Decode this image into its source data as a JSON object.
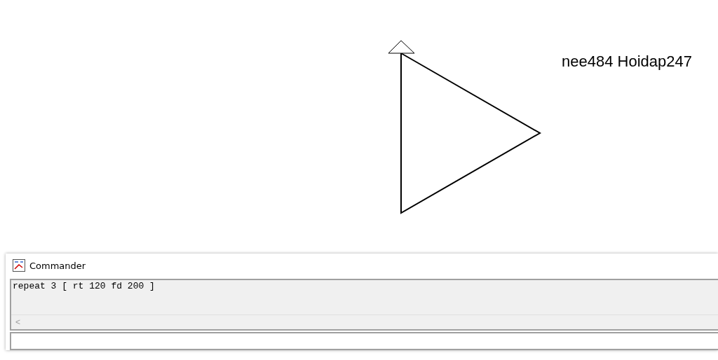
{
  "canvas": {
    "label": "nee484 Hoidap247"
  },
  "commander": {
    "title": "Commander",
    "history": [
      "repeat 3 [ rt 120 fd 200 ]"
    ],
    "scroll_left": "<"
  }
}
